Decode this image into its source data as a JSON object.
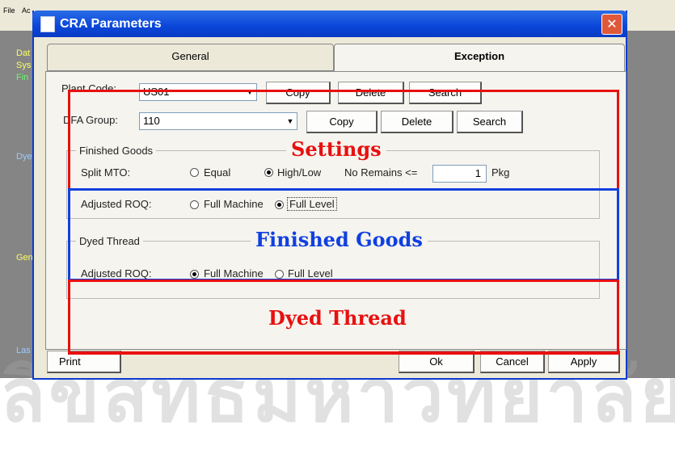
{
  "background": {
    "menu_items": [
      "File",
      "Ac"
    ],
    "side_labels": [
      "Dat",
      "Sys",
      "Fin",
      "Dye",
      "Gen",
      "Las"
    ],
    "watermark": "ลิขสิทธิ์มหาวิทยาลัยเชียงใหม่"
  },
  "dialog": {
    "title": "CRA Parameters",
    "close_label": "✕",
    "tabs": [
      {
        "label": "General",
        "active": false
      },
      {
        "label": "Exception",
        "active": true
      }
    ],
    "plant_code": {
      "label": "Plant Code:",
      "value": "US01"
    },
    "dfa_group": {
      "label": "DFA Group:",
      "value": "110"
    },
    "row1_buttons": {
      "copy": "Copy",
      "delete": "Delete",
      "search": "Search"
    },
    "row2_buttons": {
      "copy": "Copy",
      "delete": "Delete",
      "search": "Search"
    },
    "finished_goods": {
      "group_label": "Finished Goods",
      "split_mto_label": "Split MTO:",
      "equal_label": "Equal",
      "highlow_label": "High/Low",
      "selected_split": "High/Low",
      "no_remains_label": "No Remains <=",
      "no_remains_value": "1",
      "unit": "Pkg",
      "adjusted_roq_label": "Adjusted ROQ:",
      "full_machine_label": "Full Machine",
      "full_level_label": "Full Level",
      "selected_roq": "Full Level"
    },
    "dyed_thread": {
      "group_label": "Dyed Thread",
      "adjusted_roq_label": "Adjusted ROQ:",
      "full_machine_label": "Full Machine",
      "full_level_label": "Full Level",
      "selected_roq": "Full Machine"
    },
    "footer": {
      "print": "Print",
      "ok": "Ok",
      "cancel": "Cancel",
      "apply": "Apply"
    }
  },
  "annotations": {
    "settings": {
      "label": "Settings",
      "color": "#e81010"
    },
    "finished_goods": {
      "label": "Finished Goods",
      "color": "#1040e0"
    },
    "dyed_thread": {
      "label": "Dyed Thread",
      "color": "#e81010"
    }
  }
}
